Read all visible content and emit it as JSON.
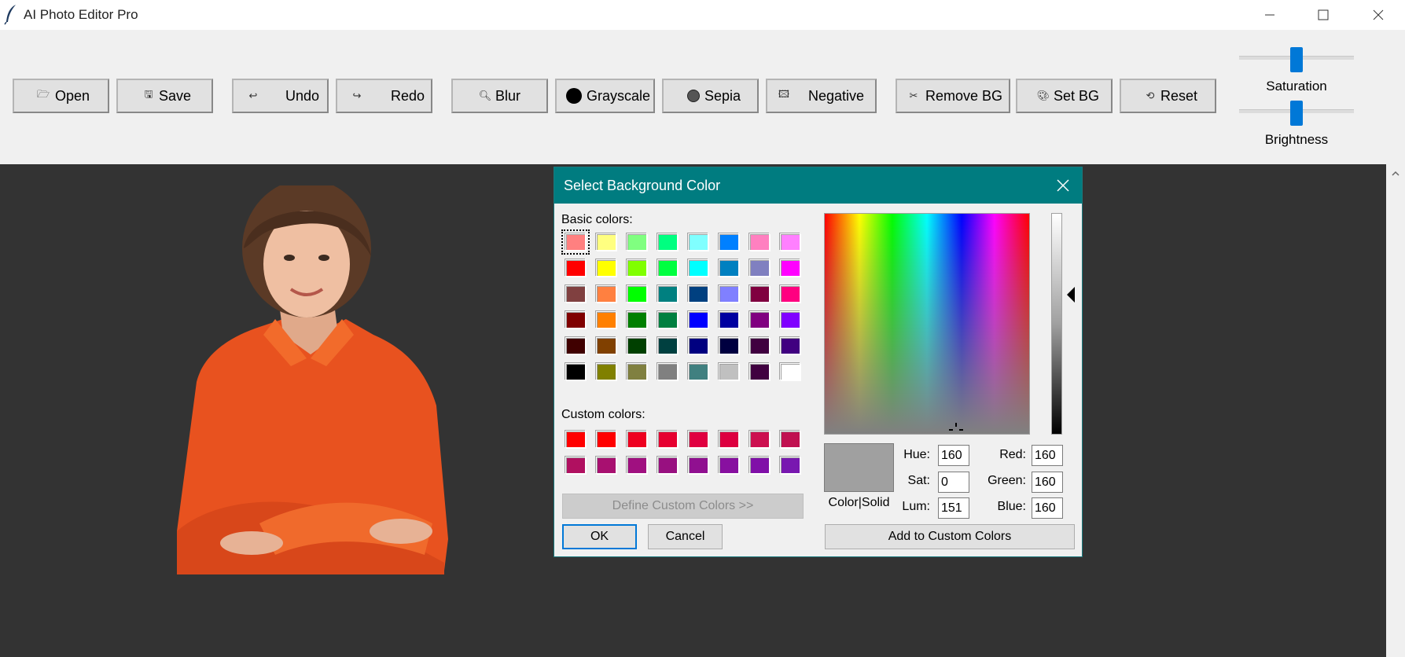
{
  "window": {
    "title": "AI Photo Editor Pro"
  },
  "toolbar": {
    "buttons": [
      {
        "label": "Open",
        "icon": "folder-icon"
      },
      {
        "label": "Save",
        "icon": "floppy-icon"
      },
      {
        "label": "Undo",
        "icon": "undo-icon"
      },
      {
        "label": "Redo",
        "icon": "redo-icon"
      },
      {
        "label": "Blur",
        "icon": "magnifier-icon"
      },
      {
        "label": "Grayscale",
        "icon": "black-circle-icon"
      },
      {
        "label": "Sepia",
        "icon": "sepia-circle-icon"
      },
      {
        "label": "Negative",
        "icon": "film-icon"
      },
      {
        "label": "Remove BG",
        "icon": "scissors-icon"
      },
      {
        "label": "Set BG",
        "icon": "palette-icon"
      },
      {
        "label": "Reset",
        "icon": "reset-icon"
      }
    ],
    "sliders": [
      {
        "label": "Saturation",
        "value": 0.5
      },
      {
        "label": "Brightness",
        "value": 0.5
      }
    ]
  },
  "dialog": {
    "title": "Select Background Color",
    "basic_colors_label": "Basic colors:",
    "basic_colors": [
      [
        "#ff8080",
        "#ffff80",
        "#80ff80",
        "#00ff80",
        "#80ffff",
        "#0080ff",
        "#ff80c0",
        "#ff80ff"
      ],
      [
        "#ff0000",
        "#ffff00",
        "#80ff00",
        "#00ff40",
        "#00ffff",
        "#0080c0",
        "#8080c0",
        "#ff00ff"
      ],
      [
        "#804040",
        "#ff8040",
        "#00ff00",
        "#008080",
        "#004080",
        "#8080ff",
        "#800040",
        "#ff0080"
      ],
      [
        "#800000",
        "#ff8000",
        "#008000",
        "#008040",
        "#0000ff",
        "#0000a0",
        "#800080",
        "#8000ff"
      ],
      [
        "#400000",
        "#804000",
        "#004000",
        "#004040",
        "#000080",
        "#000040",
        "#400040",
        "#400080"
      ],
      [
        "#000000",
        "#808000",
        "#808040",
        "#808080",
        "#408080",
        "#c0c0c0",
        "#400040",
        "#ffffff"
      ]
    ],
    "custom_colors_label": "Custom colors:",
    "custom_colors": [
      [
        "#ff0000",
        "#ff0000",
        "#ee0020",
        "#e60030",
        "#e00040",
        "#dd0040",
        "#cc1050",
        "#c01050"
      ],
      [
        "#b01060",
        "#a81070",
        "#a01080",
        "#981080",
        "#901090",
        "#8810a0",
        "#8010a8",
        "#7818b0"
      ]
    ],
    "define_custom_label": "Define Custom Colors >>",
    "ok_label": "OK",
    "cancel_label": "Cancel",
    "preview_label": "Color|Solid",
    "preview_color": "#a0a0a0",
    "fields": {
      "hue_label": "Hue:",
      "hue": "160",
      "sat_label": "Sat:",
      "sat": "0",
      "lum_label": "Lum:",
      "lum": "151",
      "red_label": "Red:",
      "red": "160",
      "green_label": "Green:",
      "green": "160",
      "blue_label": "Blue:",
      "blue": "160"
    },
    "add_custom_label": "Add to Custom Colors"
  },
  "colors": {
    "title_bar": "#007c80",
    "canvas_bg": "#333333",
    "slider_accent": "#0078d7"
  }
}
